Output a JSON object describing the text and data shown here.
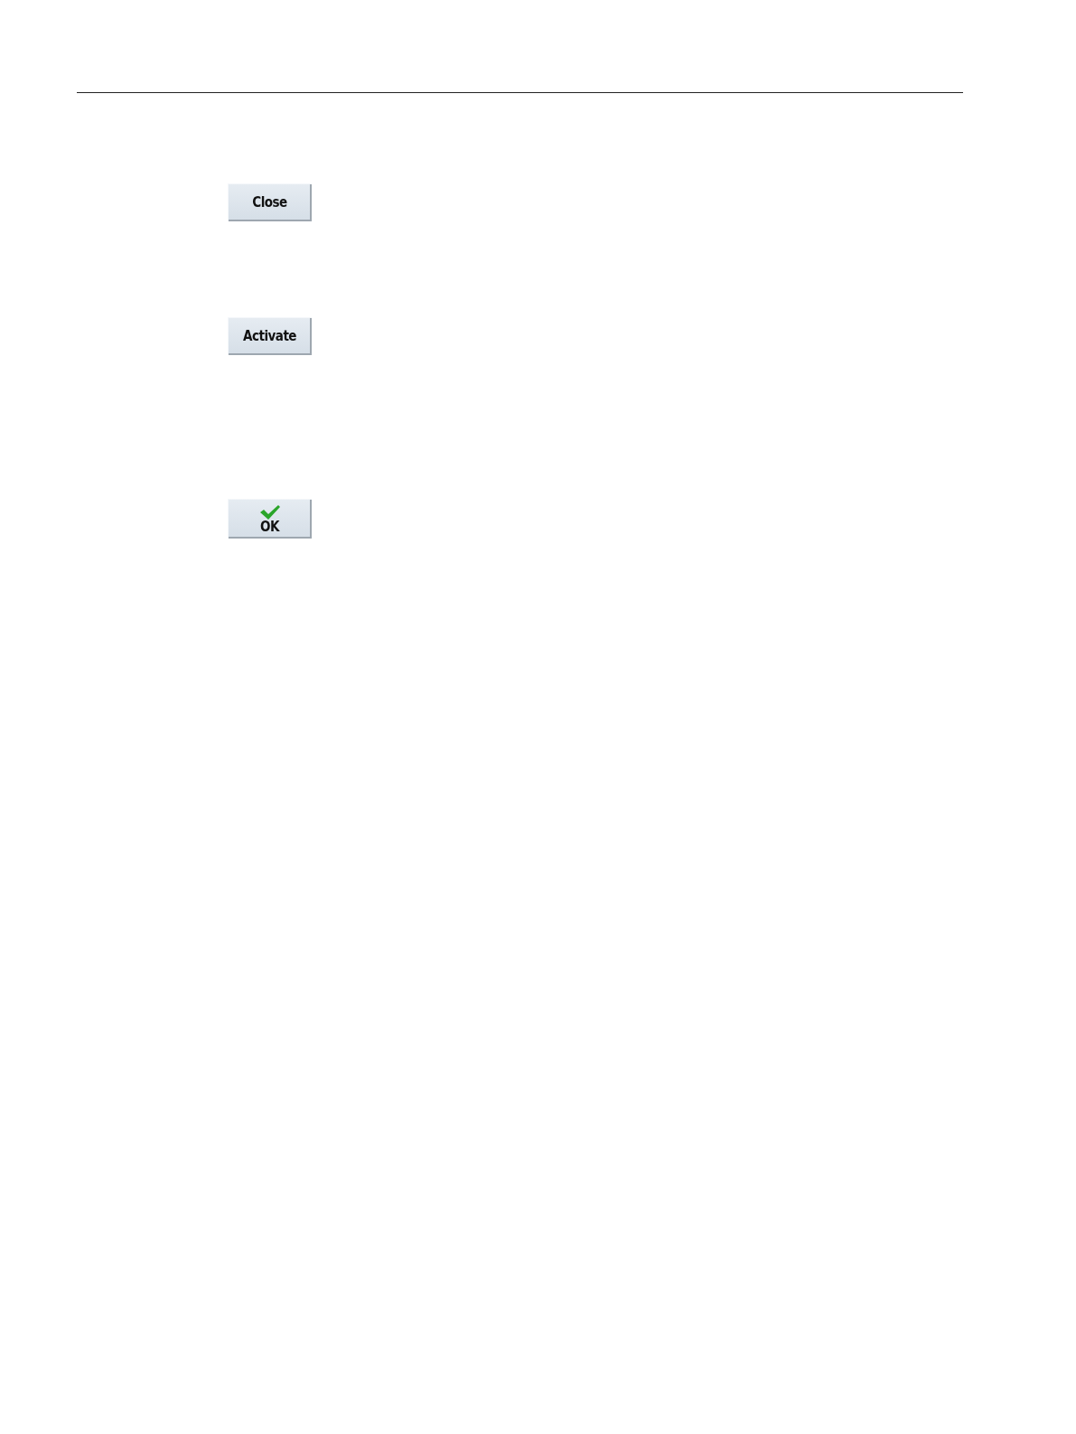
{
  "softkeys": [
    {
      "label": "Close",
      "kind": "plain"
    },
    {
      "label": "Activate",
      "kind": "plain"
    },
    {
      "label": "OK",
      "kind": "with-icon"
    }
  ]
}
